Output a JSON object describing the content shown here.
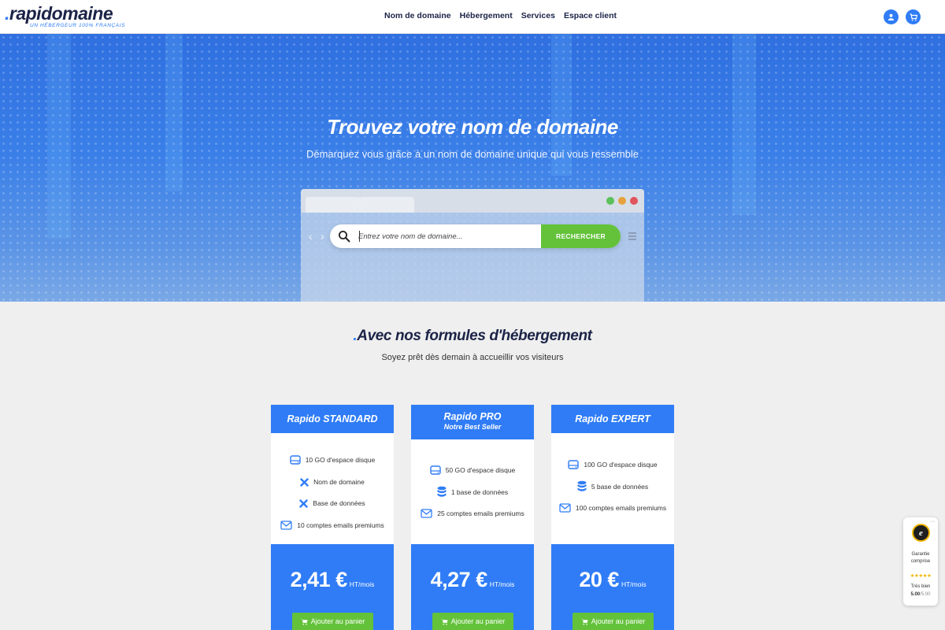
{
  "header": {
    "logo": {
      "dot": ".",
      "name": "rapidomaine",
      "tagline": "UN HÉBERGEUR 100% FRANÇAIS"
    },
    "nav": [
      "Nom de domaine",
      "Hébergement",
      "Services",
      "Espace client"
    ],
    "icons": [
      "user-icon",
      "cart-icon"
    ],
    "accent_color": "#2f7cf6"
  },
  "hero": {
    "title": "Trouvez votre nom de domaine",
    "subtitle": "Démarquez vous grâce à un nom de domaine unique qui vous ressemble",
    "search": {
      "placeholder": "Entrez votre nom de domaine...",
      "value": "",
      "button": "RECHERCHER",
      "button_color": "#63c23a"
    }
  },
  "hosting": {
    "title_dot": ".",
    "title": "Avec nos formules d'hébergement",
    "subtitle": "Soyez prêt dès demain à accueillir vos visiteurs",
    "plans": [
      {
        "name": "Rapido STANDARD",
        "subtitle": "",
        "features": [
          {
            "icon": "disk-icon",
            "text": "10 GO d'espace disque"
          },
          {
            "icon": "cross-icon",
            "text": "Nom de domaine"
          },
          {
            "icon": "cross-icon",
            "text": "Base de données"
          },
          {
            "icon": "envelope-icon",
            "text": "10 comptes emails premiums"
          }
        ],
        "price": "2,41 €",
        "price_unit": "HT/mois",
        "cta": "Ajouter au panier"
      },
      {
        "name": "Rapido PRO",
        "subtitle": "Notre Best Seller",
        "features": [
          {
            "icon": "disk-icon",
            "text": "50 GO d'espace disque"
          },
          {
            "icon": "database-icon",
            "text": "1 base de données"
          },
          {
            "icon": "envelope-icon",
            "text": "25 comptes emails premiums"
          }
        ],
        "price": "4,27 €",
        "price_unit": "HT/mois",
        "cta": "Ajouter au panier"
      },
      {
        "name": "Rapido EXPERT",
        "subtitle": "",
        "features": [
          {
            "icon": "disk-icon",
            "text": "100 GO d'espace disque"
          },
          {
            "icon": "database-icon",
            "text": "5 base de données"
          },
          {
            "icon": "envelope-icon",
            "text": "100 comptes emails premiums"
          }
        ],
        "price": "20 €",
        "price_unit": "HT/mois",
        "cta": "Ajouter au panier"
      }
    ]
  },
  "trust_badge": {
    "seal": "e",
    "line1": "Garantie",
    "line2": "comprise",
    "stars": "★★★★★",
    "rating_label": "Très bien",
    "score": "5.00",
    "scale": "/5.00",
    "more": "···"
  }
}
